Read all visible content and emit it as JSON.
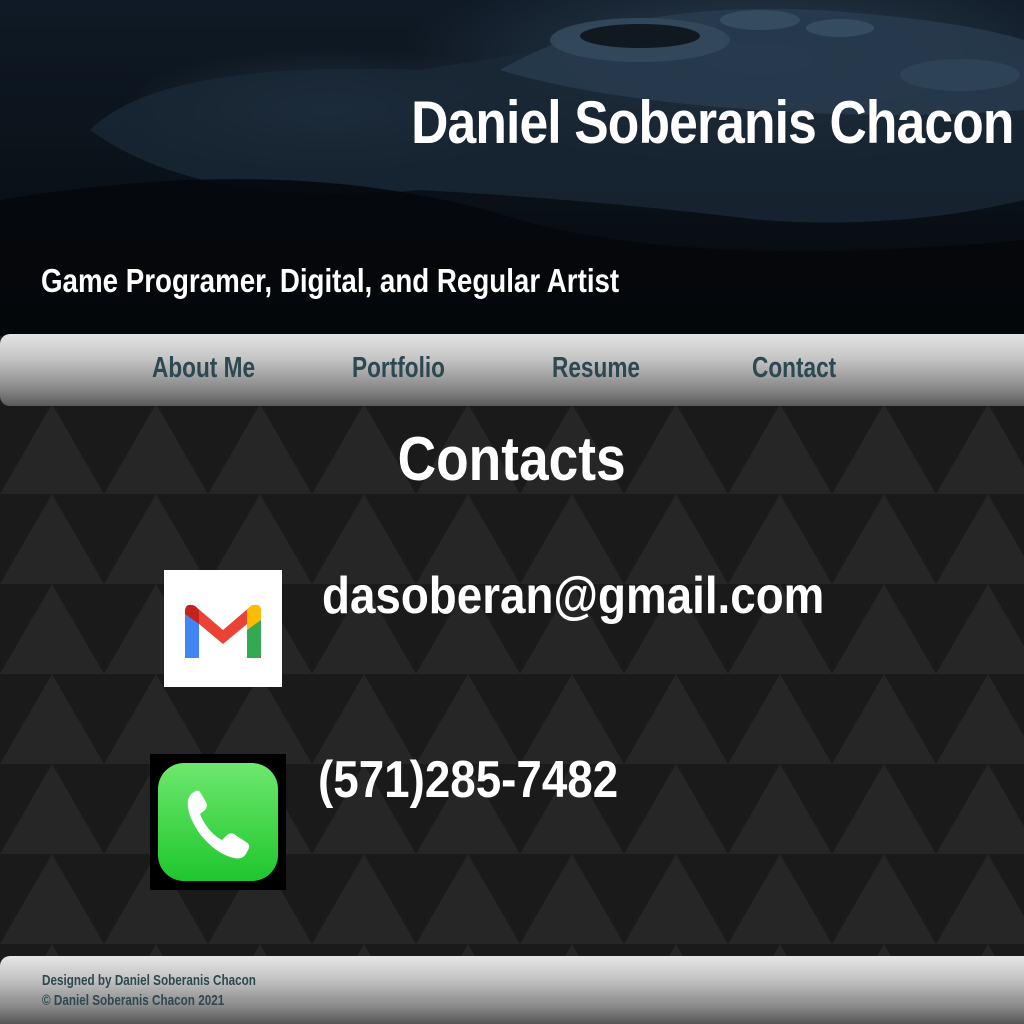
{
  "header": {
    "title": "Daniel Soberanis Chacon",
    "tagline": "Game Programer, Digital, and Regular Artist"
  },
  "nav": {
    "items": [
      {
        "label": "About Me"
      },
      {
        "label": "Portfolio"
      },
      {
        "label": "Resume"
      },
      {
        "label": "Contact"
      }
    ]
  },
  "main": {
    "heading": "Contacts",
    "email": {
      "icon": "gmail-icon",
      "text": "dasoberan@gmail.com"
    },
    "phone": {
      "icon": "phone-icon",
      "text": "(571)285-7482"
    }
  },
  "footer": {
    "designed_by": "Designed by Daniel Soberanis Chacon",
    "copyright": "© Daniel Soberanis Chacon 2021"
  },
  "colors": {
    "nav_text": "#2d4850",
    "text": "#ffffff",
    "background": "#1e1e1e"
  }
}
